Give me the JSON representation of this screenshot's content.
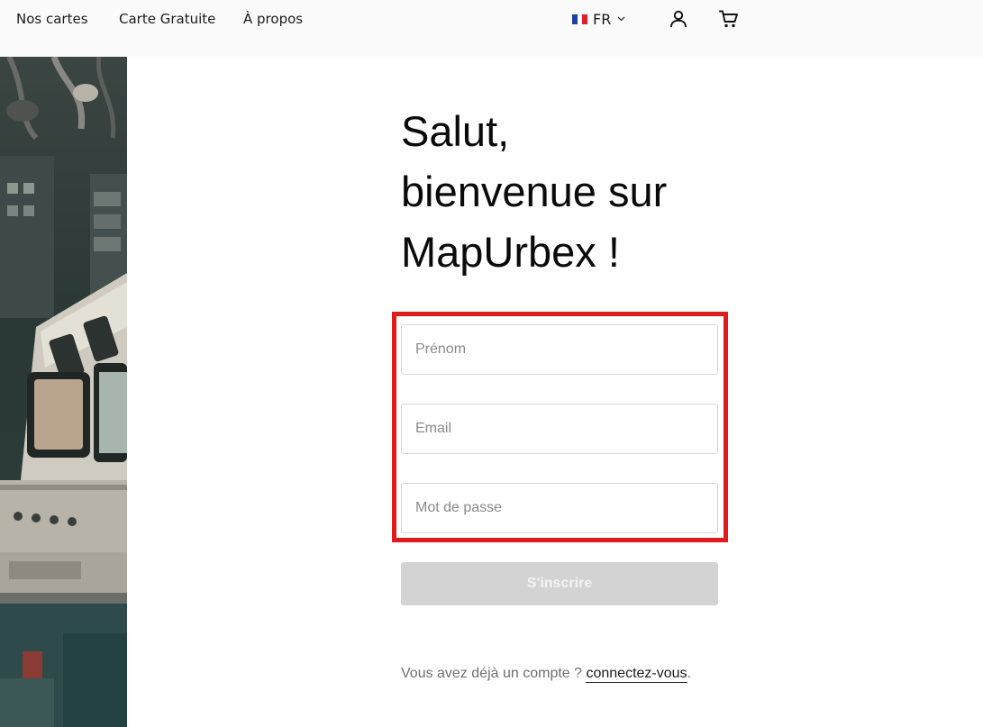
{
  "header": {
    "nav": [
      {
        "label": "Nos cartes"
      },
      {
        "label": "Carte Gratuite"
      },
      {
        "label": "À propos"
      }
    ],
    "language": {
      "label": "FR",
      "flag_colors": [
        "#1f3da8",
        "#ffffff",
        "#e3202a"
      ]
    },
    "icons": [
      "user-icon",
      "cart-icon",
      "chevron-down-icon"
    ]
  },
  "side_image": {
    "description_icon": "industrial-control-room-photo"
  },
  "main": {
    "heading": {
      "line1": "Salut,",
      "line2": "bienvenue sur",
      "line3": "MapUrbex !"
    },
    "form": {
      "prenom": {
        "placeholder": "Prénom",
        "value": ""
      },
      "email": {
        "placeholder": "Email",
        "value": ""
      },
      "password": {
        "placeholder": "Mot de passe",
        "value": ""
      },
      "submit_label": "S'inscrire"
    },
    "login": {
      "prefix": "Vous avez déjà un compte ? ",
      "link_label": "connectez-vous",
      "suffix": "."
    }
  },
  "colors": {
    "highlight": "#e01b1b",
    "button_disabled": "#d3d3d3",
    "header_bg": "#fbfbfb"
  }
}
